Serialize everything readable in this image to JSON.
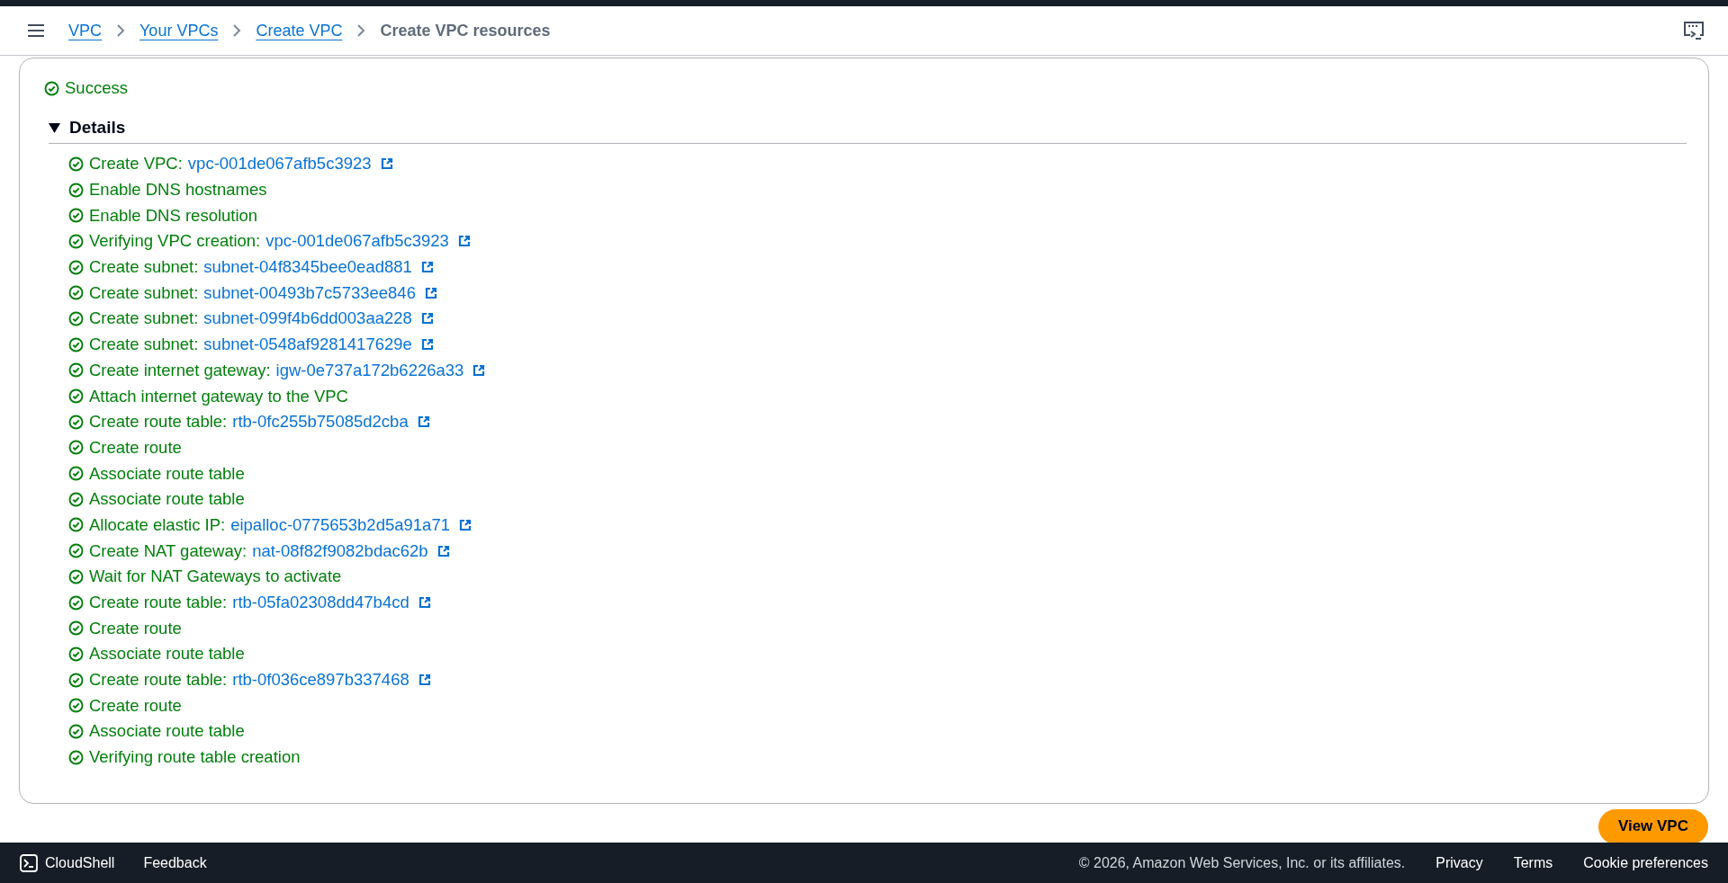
{
  "breadcrumbs": [
    {
      "label": "VPC",
      "link": true
    },
    {
      "label": "Your VPCs",
      "link": true
    },
    {
      "label": "Create VPC",
      "link": true
    },
    {
      "label": "Create VPC resources",
      "link": false
    }
  ],
  "status": "Success",
  "details": {
    "title": "Details",
    "expanded": true,
    "steps": [
      {
        "text": "Create VPC:",
        "resource": "vpc-001de067afb5c3923"
      },
      {
        "text": "Enable DNS hostnames"
      },
      {
        "text": "Enable DNS resolution"
      },
      {
        "text": "Verifying VPC creation:",
        "resource": "vpc-001de067afb5c3923"
      },
      {
        "text": "Create subnet:",
        "resource": "subnet-04f8345bee0ead881"
      },
      {
        "text": "Create subnet:",
        "resource": "subnet-00493b7c5733ee846"
      },
      {
        "text": "Create subnet:",
        "resource": "subnet-099f4b6dd003aa228"
      },
      {
        "text": "Create subnet:",
        "resource": "subnet-0548af9281417629e"
      },
      {
        "text": "Create internet gateway:",
        "resource": "igw-0e737a172b6226a33"
      },
      {
        "text": "Attach internet gateway to the VPC"
      },
      {
        "text": "Create route table:",
        "resource": "rtb-0fc255b75085d2cba"
      },
      {
        "text": "Create route"
      },
      {
        "text": "Associate route table"
      },
      {
        "text": "Associate route table"
      },
      {
        "text": "Allocate elastic IP:",
        "resource": "eipalloc-0775653b2d5a91a71"
      },
      {
        "text": "Create NAT gateway:",
        "resource": "nat-08f82f9082bdac62b"
      },
      {
        "text": "Wait for NAT Gateways to activate"
      },
      {
        "text": "Create route table:",
        "resource": "rtb-05fa02308dd47b4cd"
      },
      {
        "text": "Create route"
      },
      {
        "text": "Associate route table"
      },
      {
        "text": "Create route table:",
        "resource": "rtb-0f036ce897b337468"
      },
      {
        "text": "Create route"
      },
      {
        "text": "Associate route table"
      },
      {
        "text": "Verifying route table creation"
      }
    ]
  },
  "primary_button": "View VPC",
  "footer": {
    "cloudshell": "CloudShell",
    "feedback": "Feedback",
    "copyright": "© 2026, Amazon Web Services, Inc. or its affiliates.",
    "links": [
      "Privacy",
      "Terms",
      "Cookie preferences"
    ]
  }
}
